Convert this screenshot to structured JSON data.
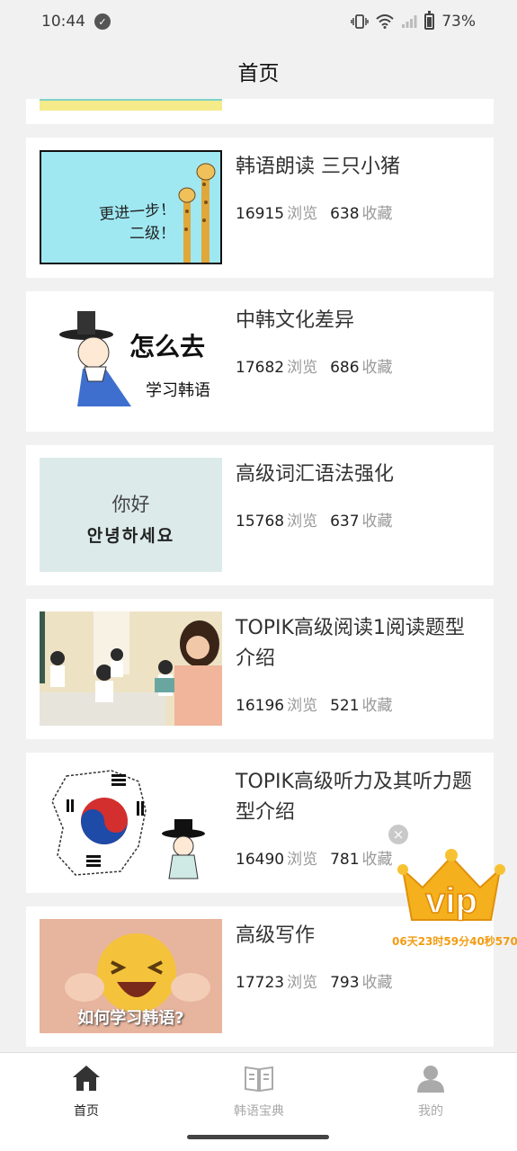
{
  "status": {
    "time": "10:44",
    "battery": "73%"
  },
  "header": {
    "title": "首页"
  },
  "cards": [
    {
      "title": "韩语朗读 三只小猪",
      "views": "16915",
      "views_label": "浏览",
      "favs": "638",
      "favs_label": "收藏",
      "thumb_text": [
        "更进一步！",
        "二级！"
      ]
    },
    {
      "title": "中韩文化差异",
      "views": "17682",
      "views_label": "浏览",
      "favs": "686",
      "favs_label": "收藏",
      "thumb_text": [
        "怎么去",
        "学习韩语"
      ]
    },
    {
      "title": "高级词汇语法强化",
      "views": "15768",
      "views_label": "浏览",
      "favs": "637",
      "favs_label": "收藏",
      "thumb_text": [
        "你好",
        "안녕하세요"
      ]
    },
    {
      "title": "TOPIK高级阅读1阅读题型介绍",
      "views": "16196",
      "views_label": "浏览",
      "favs": "521",
      "favs_label": "收藏"
    },
    {
      "title": "TOPIK高级听力及其听力题型介绍",
      "views": "16490",
      "views_label": "浏览",
      "favs": "781",
      "favs_label": "收藏"
    },
    {
      "title": "高级写作",
      "views": "17723",
      "views_label": "浏览",
      "favs": "793",
      "favs_label": "收藏",
      "thumb_text": [
        "如何学习韩语?"
      ]
    }
  ],
  "vip": {
    "label": "vip",
    "countdown": "06天23时59分40秒570"
  },
  "nav": {
    "home": "首页",
    "dictionary": "韩语宝典",
    "mine": "我的"
  },
  "colors": {
    "accent": "#f5a623",
    "text": "#333333",
    "muted": "#999999"
  }
}
